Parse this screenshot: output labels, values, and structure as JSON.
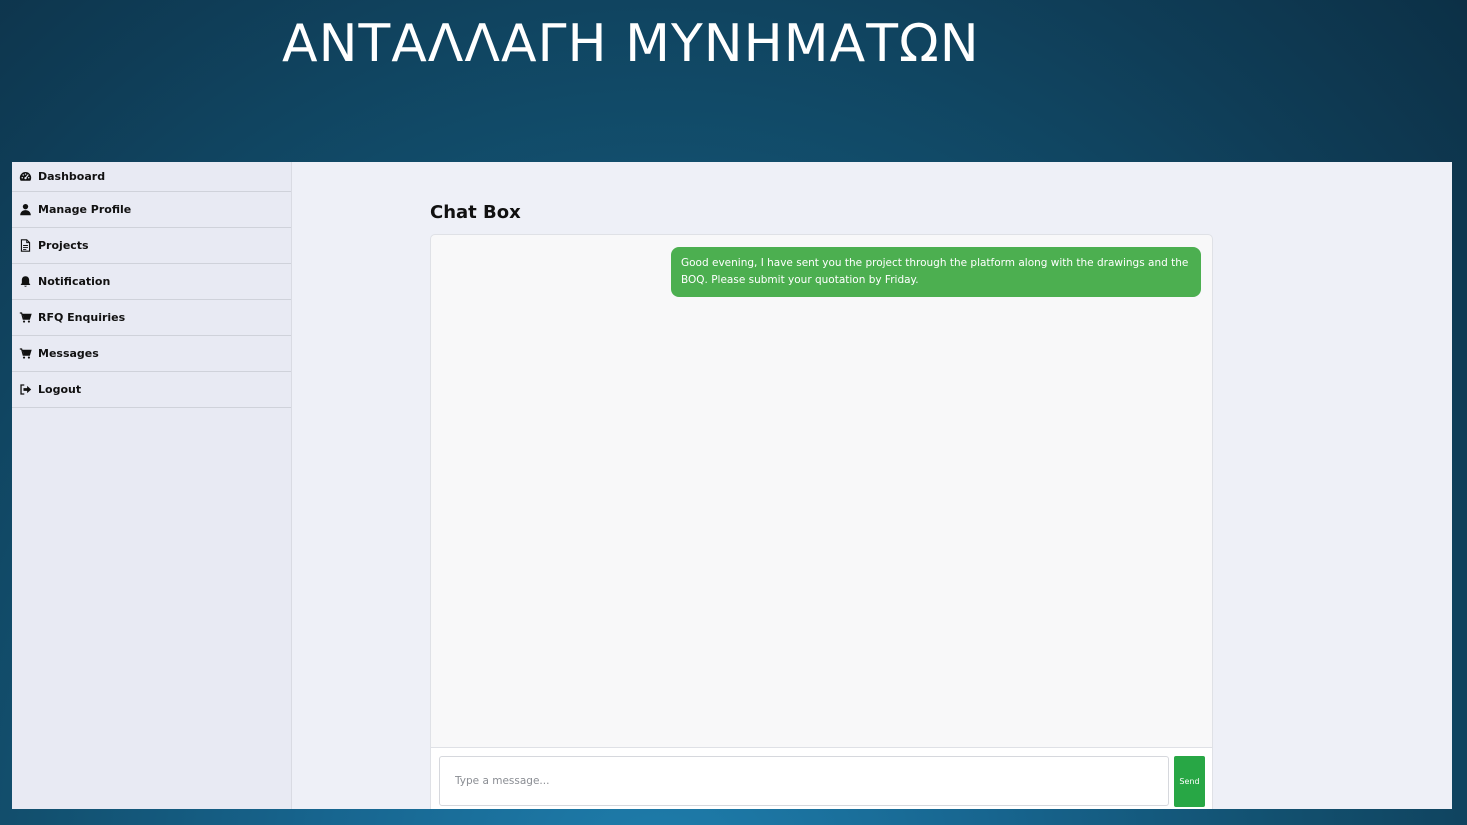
{
  "slide": {
    "title": "ΑΝΤΑΛΛΑΓΗ ΜΥΝΗΜΑΤΩΝ"
  },
  "sidebar": {
    "items": [
      {
        "label": "Dashboard",
        "icon": "dashboard-icon"
      },
      {
        "label": "Manage Profile",
        "icon": "user-icon"
      },
      {
        "label": "Projects",
        "icon": "document-icon"
      },
      {
        "label": "Notification",
        "icon": "bell-icon"
      },
      {
        "label": "RFQ Enquiries",
        "icon": "cart-icon"
      },
      {
        "label": "Messages",
        "icon": "cart-icon"
      },
      {
        "label": "Logout",
        "icon": "sign-out-icon"
      }
    ]
  },
  "chat": {
    "title": "Chat Box",
    "messages": [
      {
        "text": "Good evening, I have sent you the project through the platform along with the drawings and the BOQ. Please submit your quotation by Friday.",
        "direction": "outgoing"
      }
    ],
    "input": {
      "placeholder": "Type a message...",
      "value": ""
    },
    "send_label": "Send"
  },
  "colors": {
    "bubble": "#4caf50",
    "send_button": "#28a745",
    "app_background": "#eef0f7",
    "sidebar_background": "#e8eaf3"
  }
}
